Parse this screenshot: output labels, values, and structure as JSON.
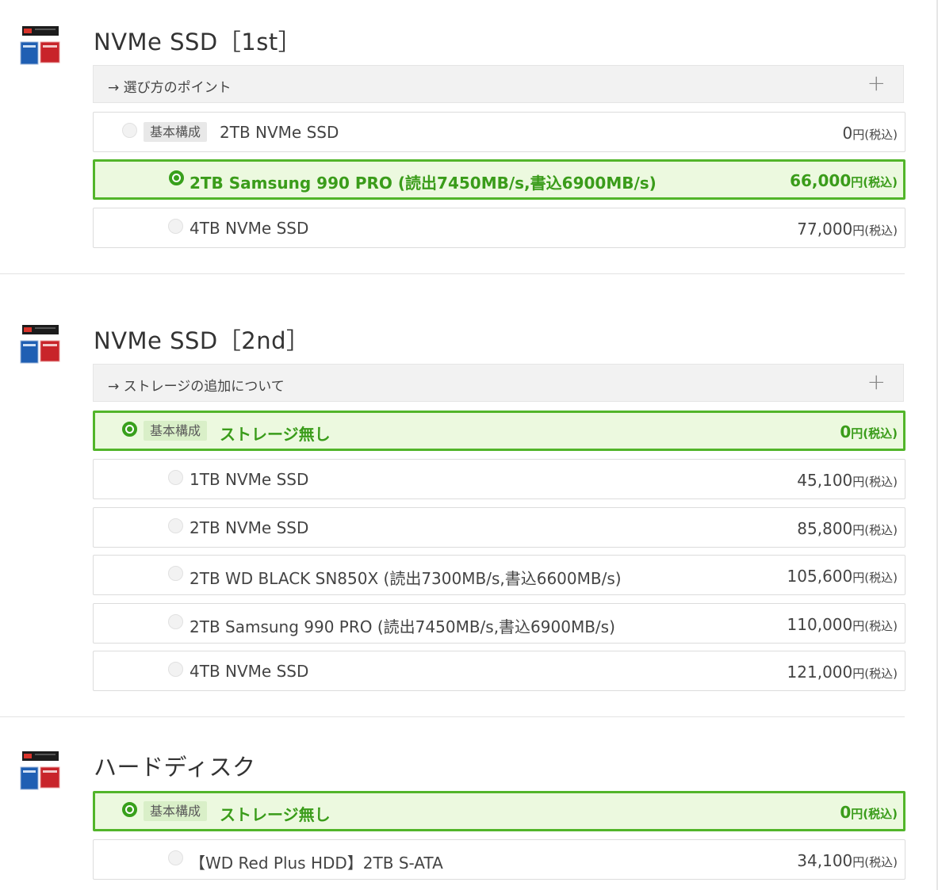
{
  "sections": [
    {
      "title": "NVMe  SSD［1st］",
      "thumb_icon": "ssd-product-icon",
      "accordion": {
        "label": "→ 選び方のポイント",
        "icon": "plus-icon",
        "symbol": "+"
      },
      "options": [
        {
          "badge": "基本構成",
          "label": "2TB NVMe SSD",
          "amount": "0",
          "yen": "円",
          "tax": "(税込)",
          "selected": false
        },
        {
          "badge": "",
          "label": "2TB Samsung 990 PRO (読出7450MB/s,書込6900MB/s)",
          "amount": "66,000",
          "yen": "円",
          "tax": "(税込)",
          "selected": true
        },
        {
          "badge": "",
          "label": "4TB NVMe SSD",
          "amount": "77,000",
          "yen": "円",
          "tax": "(税込)",
          "selected": false
        }
      ]
    },
    {
      "title": "NVMe  SSD［2nd］",
      "thumb_icon": "ssd-product-icon",
      "accordion": {
        "label": "→ ストレージの追加について",
        "icon": "plus-icon",
        "symbol": "+"
      },
      "options": [
        {
          "badge": "基本構成",
          "label": "ストレージ無し",
          "amount": "0",
          "yen": "円",
          "tax": "(税込)",
          "selected": true
        },
        {
          "badge": "",
          "label": "1TB NVMe SSD",
          "amount": "45,100",
          "yen": "円",
          "tax": "(税込)",
          "selected": false
        },
        {
          "badge": "",
          "label": "2TB NVMe SSD",
          "amount": "85,800",
          "yen": "円",
          "tax": "(税込)",
          "selected": false
        },
        {
          "badge": "",
          "label": "2TB WD BLACK SN850X (読出7300MB/s,書込6600MB/s)",
          "amount": "105,600",
          "yen": "円",
          "tax": "(税込)",
          "selected": false
        },
        {
          "badge": "",
          "label": "2TB Samsung 990 PRO (読出7450MB/s,書込6900MB/s)",
          "amount": "110,000",
          "yen": "円",
          "tax": "(税込)",
          "selected": false
        },
        {
          "badge": "",
          "label": "4TB NVMe SSD",
          "amount": "121,000",
          "yen": "円",
          "tax": "(税込)",
          "selected": false
        }
      ]
    },
    {
      "title": "ハードディスク",
      "thumb_icon": "hdd-product-icon",
      "options": [
        {
          "badge": "基本構成",
          "label": "ストレージ無し",
          "amount": "0",
          "yen": "円",
          "tax": "(税込)",
          "selected": true
        },
        {
          "badge": "",
          "label": "【WD Red Plus HDD】2TB S-ATA",
          "amount": "34,100",
          "yen": "円",
          "tax": "(税込)",
          "selected": false
        }
      ]
    }
  ],
  "colors": {
    "selected_border": "#52b52a",
    "selected_bg": "#ecf9df",
    "selected_text": "#3a9c1a",
    "accordion_bg": "#f2f2f2"
  }
}
